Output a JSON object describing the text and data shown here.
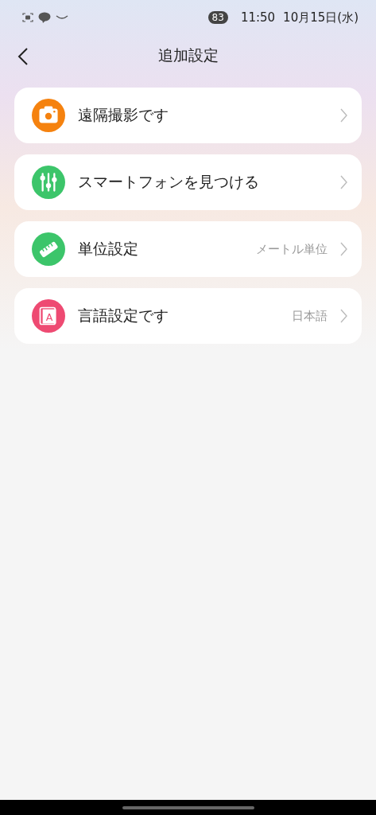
{
  "status_bar": {
    "battery": "83",
    "time": "11:50",
    "date": "10月15日(水)"
  },
  "header": {
    "title": "追加設定"
  },
  "items": [
    {
      "kind": "camera",
      "color": "#f5820f",
      "label": "遠隔撮影です"
    },
    {
      "kind": "sliders",
      "color": "#3cc56a",
      "label": "スマートフォンを見つける"
    },
    {
      "kind": "ruler",
      "color": "#3cc56a",
      "label": "単位設定",
      "value": "メートル単位"
    },
    {
      "kind": "language",
      "color": "#ee4a72",
      "label": "言語設定です",
      "icon_letter": "A",
      "value": "日本語"
    }
  ]
}
